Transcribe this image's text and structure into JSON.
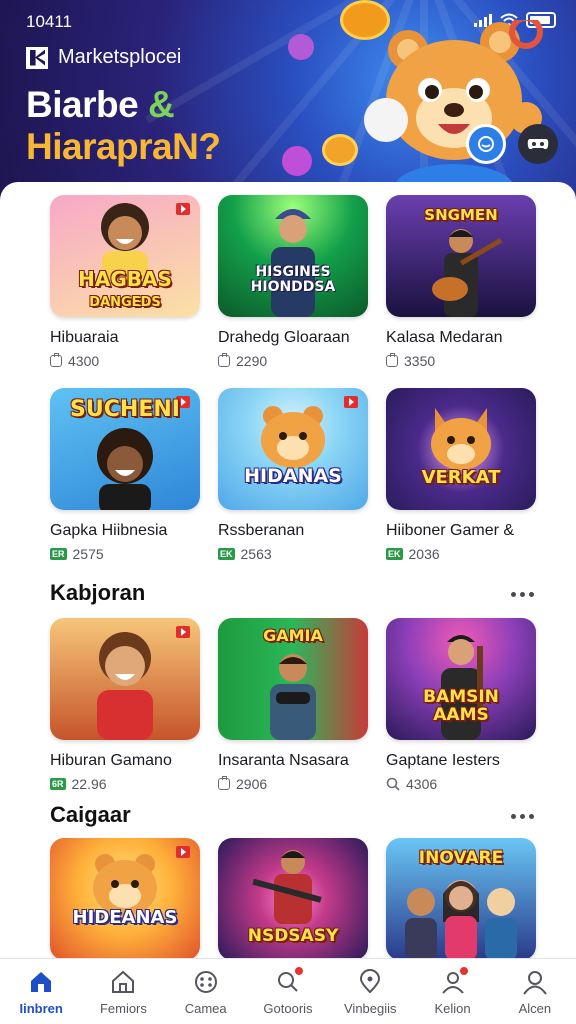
{
  "status_bar": {
    "time": "10411"
  },
  "hero": {
    "brand_name": "Marketsplocei",
    "title_line1": "Biarbe",
    "title_amp": "&",
    "title_line2": "HiarapraN?"
  },
  "rows": [
    {
      "cards": [
        {
          "title": "Hibuaraia",
          "meta_icon": "download-icon",
          "meta_value": "4300",
          "thumb_text": "HAGBAS\nDANGEDS",
          "thumb_colors": [
            "#f7a8c8",
            "#fbe1a3"
          ]
        },
        {
          "title": "Drahedg Gloaraan",
          "meta_icon": "download-icon",
          "meta_value": "2290",
          "thumb_text": "HISGINES HIONDDSA",
          "thumb_colors": [
            "#13a04a",
            "#0c5a2a"
          ]
        },
        {
          "title": "Kalasa Medaran",
          "meta_icon": "download-icon",
          "meta_value": "3350",
          "thumb_text": "SNGMEN",
          "thumb_colors": [
            "#3a2478",
            "#1a1240"
          ]
        }
      ]
    },
    {
      "cards": [
        {
          "title": "Gapka Hiibnesia",
          "meta_icon": "rating-badge",
          "meta_badge": "ER",
          "meta_value": "2575",
          "thumb_text": "SUCHENI",
          "thumb_colors": [
            "#5fc2f2",
            "#2f86d8"
          ]
        },
        {
          "title": "Rssberanan",
          "meta_icon": "rating-badge",
          "meta_badge": "EK",
          "meta_value": "2563",
          "thumb_text": "HIDANAS",
          "thumb_colors": [
            "#8cd6f5",
            "#4fa8e8"
          ]
        },
        {
          "title": "Hiiboner Gamer &",
          "meta_icon": "rating-badge",
          "meta_badge": "EK",
          "meta_value": "2036",
          "thumb_text": "VERKAT",
          "thumb_colors": [
            "#2a1c5c",
            "#4a2a8a"
          ]
        }
      ]
    }
  ],
  "sections": [
    {
      "title": "Kabjoran",
      "cards": [
        {
          "title": "Hiburan Gamano",
          "meta_icon": "rating-badge",
          "meta_badge": "6R",
          "meta_value": "22.96",
          "thumb_text": "",
          "thumb_colors": [
            "#f0a55a",
            "#c6542a"
          ]
        },
        {
          "title": "Insaranta Nsasara",
          "meta_icon": "download-icon",
          "meta_value": "2906",
          "thumb_text": "GAMIA",
          "thumb_colors": [
            "#1e9a3e",
            "#c93a3a"
          ]
        },
        {
          "title": "Gaptane Iesters",
          "meta_icon": "search-icon",
          "meta_value": "4306",
          "thumb_text": "BAMSIN AAMS",
          "thumb_colors": [
            "#8b3fb8",
            "#2a1a5a"
          ]
        }
      ]
    },
    {
      "title": "Caigaar",
      "cards": [
        {
          "title": "",
          "meta_icon": "",
          "meta_value": "",
          "thumb_text": "HIDEANAS",
          "thumb_colors": [
            "#ffb13b",
            "#e0522a"
          ]
        },
        {
          "title": "",
          "meta_icon": "",
          "meta_value": "",
          "thumb_text": "NSDSASY",
          "thumb_colors": [
            "#2a1a5a",
            "#c43a8a"
          ]
        },
        {
          "title": "",
          "meta_icon": "",
          "meta_value": "",
          "thumb_text": "INOVARE",
          "thumb_colors": [
            "#4aa2e0",
            "#2a3a8a"
          ]
        }
      ]
    }
  ],
  "bottom_nav": [
    {
      "label": "Iinbren",
      "icon": "home-icon",
      "active": true
    },
    {
      "label": "Femiors",
      "icon": "house-outline-icon"
    },
    {
      "label": "Camea",
      "icon": "gamepad-icon"
    },
    {
      "label": "Gotooris",
      "icon": "search-icon",
      "notification": true
    },
    {
      "label": "Vinbegiis",
      "icon": "location-icon"
    },
    {
      "label": "Kelion",
      "icon": "user-icon",
      "notification": true
    },
    {
      "label": "Alcen",
      "icon": "profile-icon"
    }
  ],
  "colors": {
    "hero_dark": "#1e1550",
    "hero_light": "#3f8df0",
    "accent_yellow": "#f7b733",
    "nav_active": "#1f4fc8",
    "badge_red": "#e32d2d",
    "rating_green": "#2a9a48"
  }
}
